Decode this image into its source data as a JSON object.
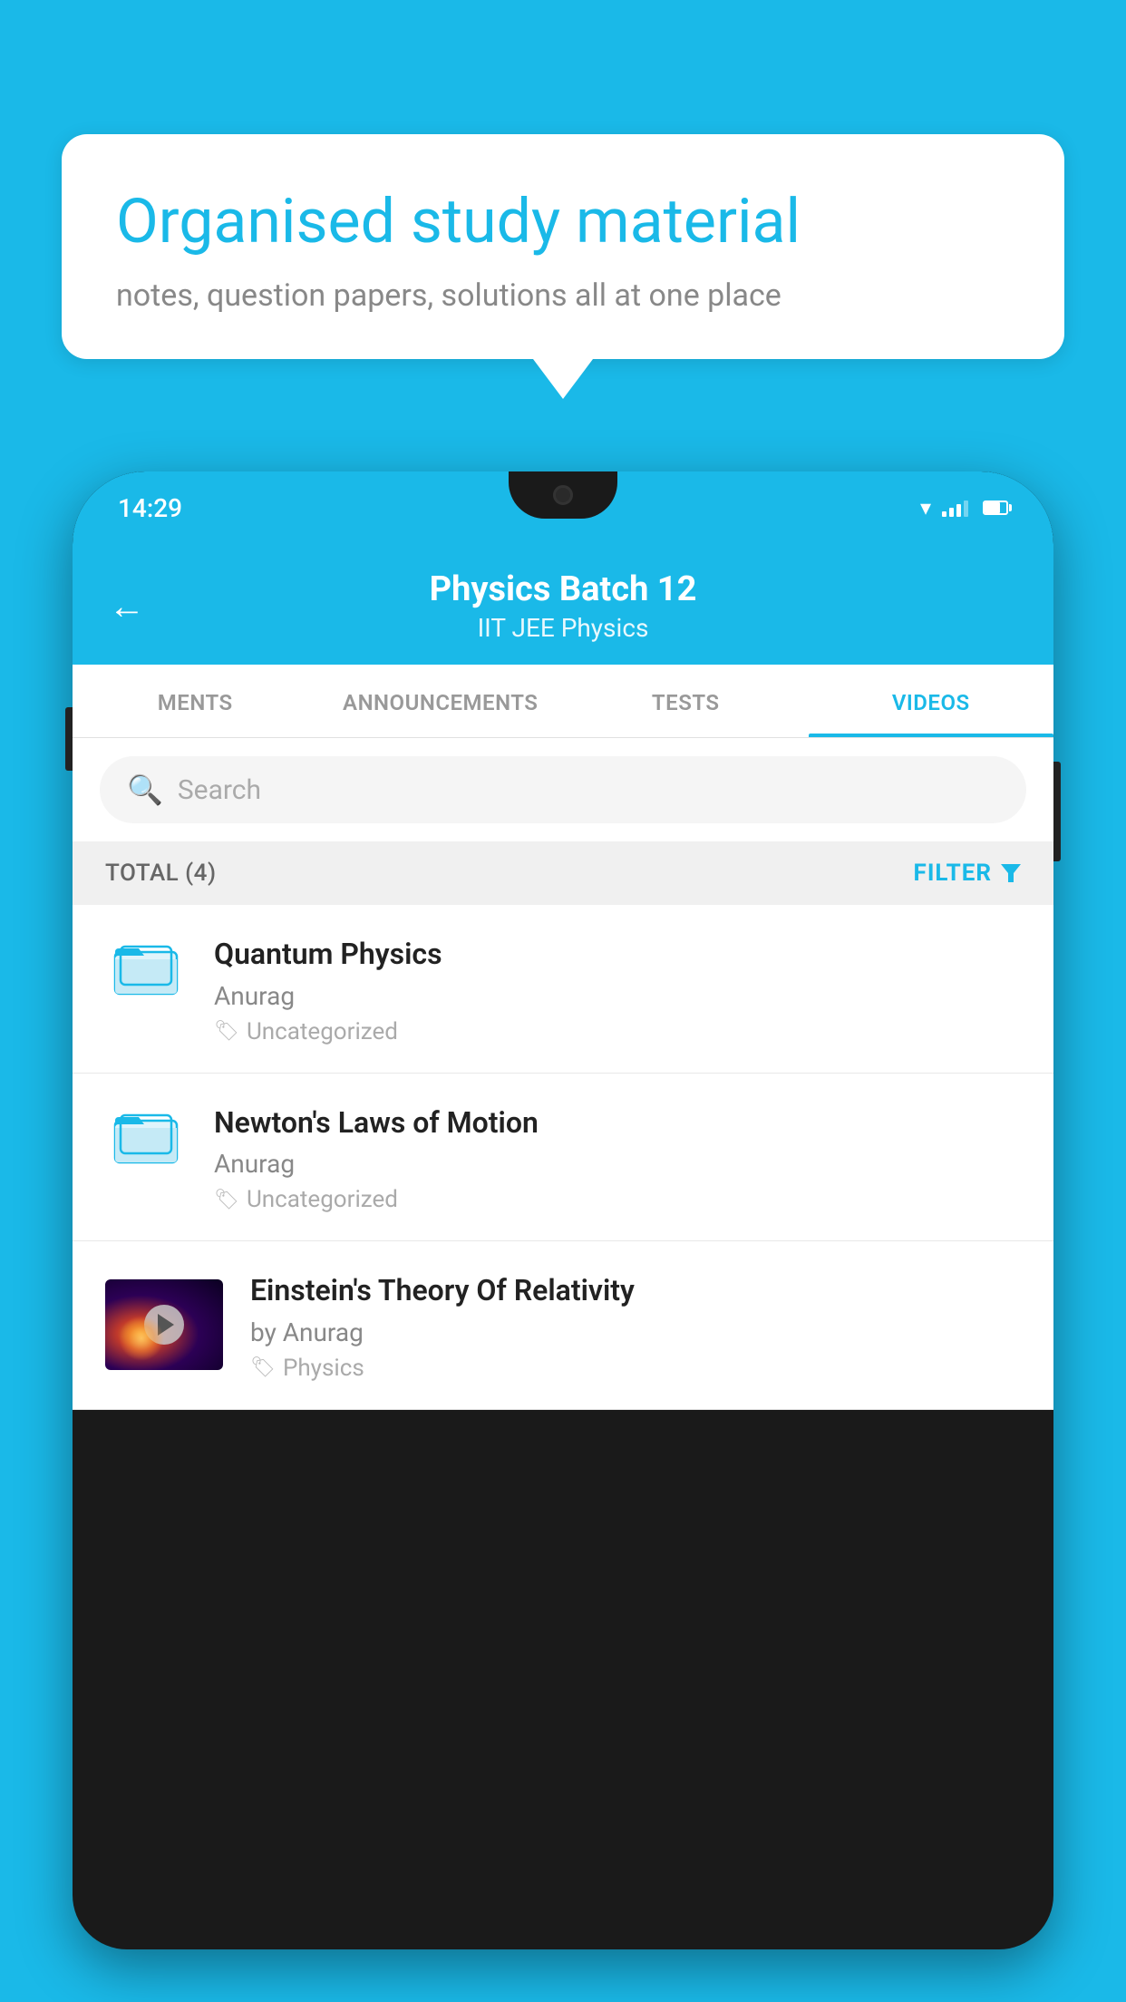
{
  "background_color": "#1ab9e8",
  "speech_bubble": {
    "title": "Organised study material",
    "subtitle": "notes, question papers, solutions all at one place"
  },
  "phone": {
    "time": "14:29",
    "header": {
      "title": "Physics Batch 12",
      "subtitle": "IIT JEE   Physics",
      "back_label": "←"
    },
    "tabs": [
      {
        "label": "MENTS",
        "active": false
      },
      {
        "label": "ANNOUNCEMENTS",
        "active": false
      },
      {
        "label": "TESTS",
        "active": false
      },
      {
        "label": "VIDEOS",
        "active": true
      }
    ],
    "search": {
      "placeholder": "Search"
    },
    "filter_bar": {
      "total_label": "TOTAL (4)",
      "filter_label": "FILTER"
    },
    "videos": [
      {
        "title": "Quantum Physics",
        "author": "Anurag",
        "tag": "Uncategorized",
        "type": "folder"
      },
      {
        "title": "Newton's Laws of Motion",
        "author": "Anurag",
        "tag": "Uncategorized",
        "type": "folder"
      },
      {
        "title": "Einstein's Theory Of Relativity",
        "author": "by Anurag",
        "tag": "Physics",
        "type": "video"
      }
    ]
  }
}
